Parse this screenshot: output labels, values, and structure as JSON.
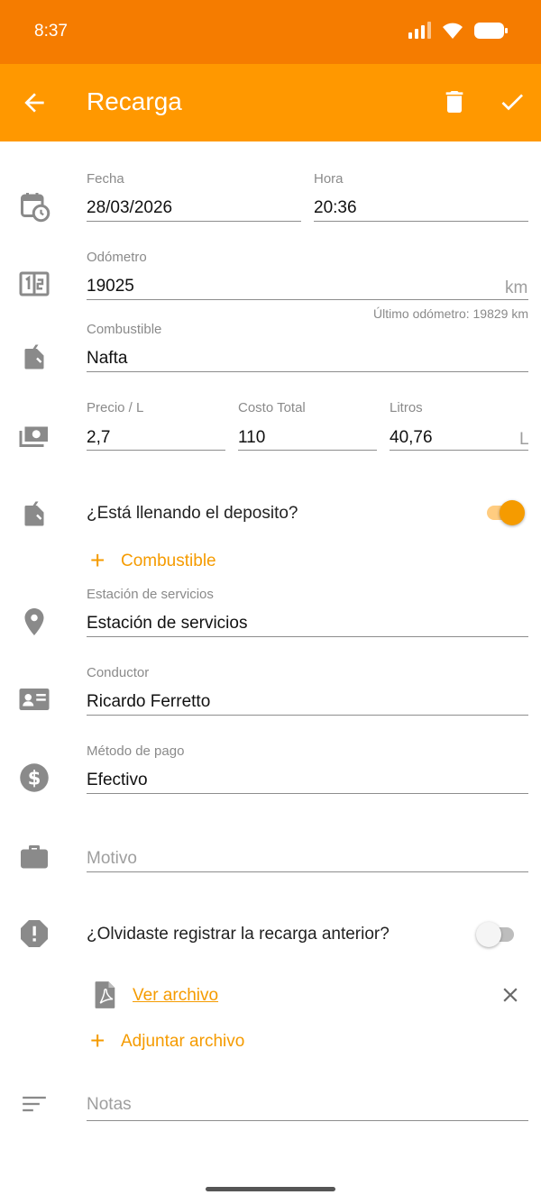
{
  "status": {
    "time": "8:37"
  },
  "toolbar": {
    "title": "Recarga"
  },
  "icons": {
    "back": "arrow-back-icon",
    "delete": "trash-icon",
    "save": "check-icon",
    "date": "calendar-clock-icon",
    "odometer": "odometer-icon",
    "fuel": "fuel-can-icon",
    "money": "money-icon",
    "station": "location-pin-icon",
    "driver": "id-card-icon",
    "payment": "dollar-circle-icon",
    "reason": "briefcase-icon",
    "alert": "alert-octagon-icon",
    "file": "pdf-file-icon",
    "notes": "notes-lines-icon"
  },
  "form": {
    "fecha": {
      "label": "Fecha",
      "value": "28/03/2026"
    },
    "hora": {
      "label": "Hora",
      "value": "20:36"
    },
    "odometro": {
      "label": "Odómetro",
      "value": "19025",
      "unit": "km",
      "hint": "Último odómetro: 19829 km"
    },
    "combustible": {
      "label": "Combustible",
      "value": "Nafta"
    },
    "precio": {
      "label": "Precio / L",
      "value": "2,7"
    },
    "costo": {
      "label": "Costo Total",
      "value": "110"
    },
    "litros": {
      "label": "Litros",
      "value": "40,76",
      "unit": "L"
    },
    "lleno": {
      "label": "¿Está llenando el deposito?",
      "checked": true
    },
    "add_fuel": {
      "label": "Combustible"
    },
    "estacion": {
      "label": "Estación de servicios",
      "value": "Estación de servicios"
    },
    "conductor": {
      "label": "Conductor",
      "value": "Ricardo Ferretto"
    },
    "metodo": {
      "label": "Método de pago",
      "value": "Efectivo"
    },
    "motivo": {
      "placeholder": "Motivo"
    },
    "olvidaste": {
      "label": "¿Olvidaste registrar la recarga anterior?",
      "checked": false
    },
    "archivo": {
      "label": "Ver archivo"
    },
    "adjuntar": {
      "label": "Adjuntar archivo"
    },
    "notas": {
      "placeholder": "Notas"
    }
  },
  "colors": {
    "status_bar": "#f57c00",
    "app_bar": "#ff9800",
    "accent": "#f59b00"
  }
}
